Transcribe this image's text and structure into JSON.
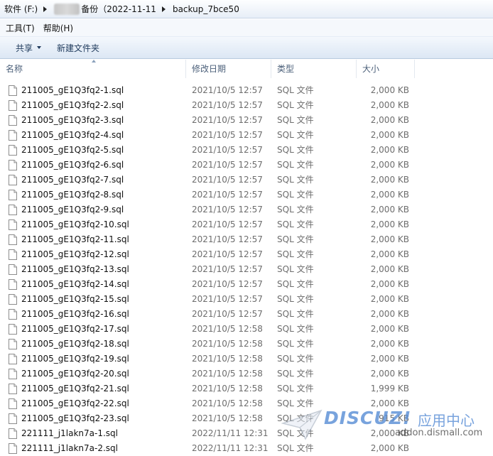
{
  "breadcrumb": {
    "segments": [
      "软件 (F:)",
      "备份（2022-11-11",
      "backup_7bce50"
    ]
  },
  "menubar": {
    "items": [
      "工具(T)",
      "帮助(H)"
    ]
  },
  "toolbar": {
    "share_label": "共享",
    "new_folder_label": "新建文件夹"
  },
  "columns": {
    "name": "名称",
    "date": "修改日期",
    "type": "类型",
    "size": "大小"
  },
  "files": [
    {
      "name": "211005_gE1Q3fq2-1.sql",
      "date": "2021/10/5 12:57",
      "type": "SQL 文件",
      "size": "2,000 KB"
    },
    {
      "name": "211005_gE1Q3fq2-2.sql",
      "date": "2021/10/5 12:57",
      "type": "SQL 文件",
      "size": "2,000 KB"
    },
    {
      "name": "211005_gE1Q3fq2-3.sql",
      "date": "2021/10/5 12:57",
      "type": "SQL 文件",
      "size": "2,000 KB"
    },
    {
      "name": "211005_gE1Q3fq2-4.sql",
      "date": "2021/10/5 12:57",
      "type": "SQL 文件",
      "size": "2,000 KB"
    },
    {
      "name": "211005_gE1Q3fq2-5.sql",
      "date": "2021/10/5 12:57",
      "type": "SQL 文件",
      "size": "2,000 KB"
    },
    {
      "name": "211005_gE1Q3fq2-6.sql",
      "date": "2021/10/5 12:57",
      "type": "SQL 文件",
      "size": "2,000 KB"
    },
    {
      "name": "211005_gE1Q3fq2-7.sql",
      "date": "2021/10/5 12:57",
      "type": "SQL 文件",
      "size": "2,000 KB"
    },
    {
      "name": "211005_gE1Q3fq2-8.sql",
      "date": "2021/10/5 12:57",
      "type": "SQL 文件",
      "size": "2,000 KB"
    },
    {
      "name": "211005_gE1Q3fq2-9.sql",
      "date": "2021/10/5 12:57",
      "type": "SQL 文件",
      "size": "2,000 KB"
    },
    {
      "name": "211005_gE1Q3fq2-10.sql",
      "date": "2021/10/5 12:57",
      "type": "SQL 文件",
      "size": "2,000 KB"
    },
    {
      "name": "211005_gE1Q3fq2-11.sql",
      "date": "2021/10/5 12:57",
      "type": "SQL 文件",
      "size": "2,000 KB"
    },
    {
      "name": "211005_gE1Q3fq2-12.sql",
      "date": "2021/10/5 12:57",
      "type": "SQL 文件",
      "size": "2,000 KB"
    },
    {
      "name": "211005_gE1Q3fq2-13.sql",
      "date": "2021/10/5 12:57",
      "type": "SQL 文件",
      "size": "2,000 KB"
    },
    {
      "name": "211005_gE1Q3fq2-14.sql",
      "date": "2021/10/5 12:57",
      "type": "SQL 文件",
      "size": "2,000 KB"
    },
    {
      "name": "211005_gE1Q3fq2-15.sql",
      "date": "2021/10/5 12:57",
      "type": "SQL 文件",
      "size": "2,000 KB"
    },
    {
      "name": "211005_gE1Q3fq2-16.sql",
      "date": "2021/10/5 12:57",
      "type": "SQL 文件",
      "size": "2,000 KB"
    },
    {
      "name": "211005_gE1Q3fq2-17.sql",
      "date": "2021/10/5 12:58",
      "type": "SQL 文件",
      "size": "2,000 KB"
    },
    {
      "name": "211005_gE1Q3fq2-18.sql",
      "date": "2021/10/5 12:58",
      "type": "SQL 文件",
      "size": "2,000 KB"
    },
    {
      "name": "211005_gE1Q3fq2-19.sql",
      "date": "2021/10/5 12:58",
      "type": "SQL 文件",
      "size": "2,000 KB"
    },
    {
      "name": "211005_gE1Q3fq2-20.sql",
      "date": "2021/10/5 12:58",
      "type": "SQL 文件",
      "size": "2,000 KB"
    },
    {
      "name": "211005_gE1Q3fq2-21.sql",
      "date": "2021/10/5 12:58",
      "type": "SQL 文件",
      "size": "1,999 KB"
    },
    {
      "name": "211005_gE1Q3fq2-22.sql",
      "date": "2021/10/5 12:58",
      "type": "SQL 文件",
      "size": "2,000 KB"
    },
    {
      "name": "211005_gE1Q3fq2-23.sql",
      "date": "2021/10/5 12:58",
      "type": "SQL 文件",
      "size": "915 KB"
    },
    {
      "name": "221111_j1lakn7a-1.sql",
      "date": "2022/11/11 12:31",
      "type": "SQL 文件",
      "size": "2,000 KB"
    },
    {
      "name": "221111_j1lakn7a-2.sql",
      "date": "2022/11/11 12:31",
      "type": "SQL 文件",
      "size": "2,000 KB"
    }
  ],
  "watermark": {
    "brand": "DISCUZ!",
    "tagline": "应用中心",
    "url": "addon.dismall.com"
  },
  "icons": {
    "file": "file-icon",
    "breadcrumb_separator": "chevron-right-icon",
    "dropdown": "chevron-down-icon",
    "sort": "sort-ascending-icon"
  },
  "colors": {
    "toolbar_text": "#1e395b",
    "header_text": "#4c607a",
    "secondary_text": "#6d6d6d",
    "watermark_blue": "#5b8fd6"
  }
}
